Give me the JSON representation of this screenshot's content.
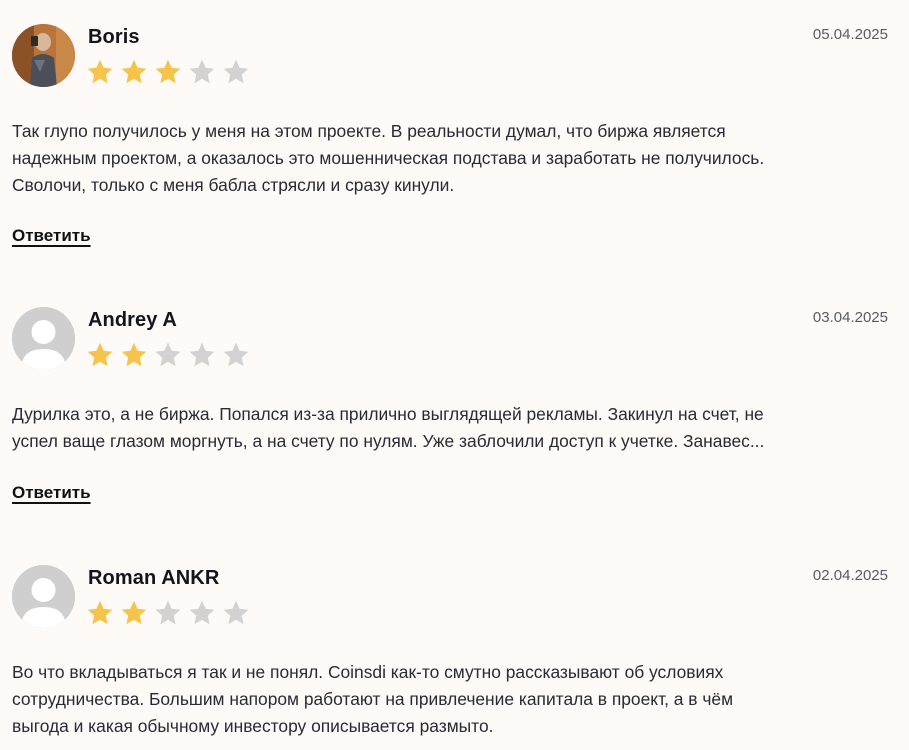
{
  "reviews": [
    {
      "author": "Boris",
      "date": "05.04.2025",
      "rating": 3,
      "max_rating": 5,
      "avatar_type": "photo",
      "text_lines": [
        "Так глупо получилось у меня на этом проекте. В реальности думал, что биржа является",
        "надежным проектом, а оказалось это мошенническая подстава и заработать не получилось.",
        "Сволочи, только с меня бабла стрясли и сразу кинули."
      ],
      "reply_label": "Ответить"
    },
    {
      "author": "Andrey A",
      "date": "03.04.2025",
      "rating": 2,
      "max_rating": 5,
      "avatar_type": "placeholder",
      "text_lines": [
        "Дурилка это, а не биржа. Попался из-за прилично выглядящей рекламы. Закинул на счет, не",
        "успел ваще глазом моргнуть, а на счету по нулям. Уже заблочили доступ к учетке. Занавес..."
      ],
      "reply_label": "Ответить"
    },
    {
      "author": "Roman ANKR",
      "date": "02.04.2025",
      "rating": 2,
      "max_rating": 5,
      "avatar_type": "placeholder",
      "text_lines": [
        "Во что вкладываться я так и не понял. Coinsdi как-то смутно рассказывают об условиях",
        "сотрудничества. Большим напором работают на привлечение капитала в проект, а в чём",
        "выгода и какая обычному инвестору описывается размыто."
      ]
    }
  ],
  "colors": {
    "background": "#fdfaf7",
    "star_filled": "#f6c44a",
    "star_empty": "#d2d2d2",
    "avatar_placeholder": "#cfcfcf"
  },
  "icons": {
    "star": "star-icon",
    "placeholder_avatar": "user-silhouette-icon"
  }
}
